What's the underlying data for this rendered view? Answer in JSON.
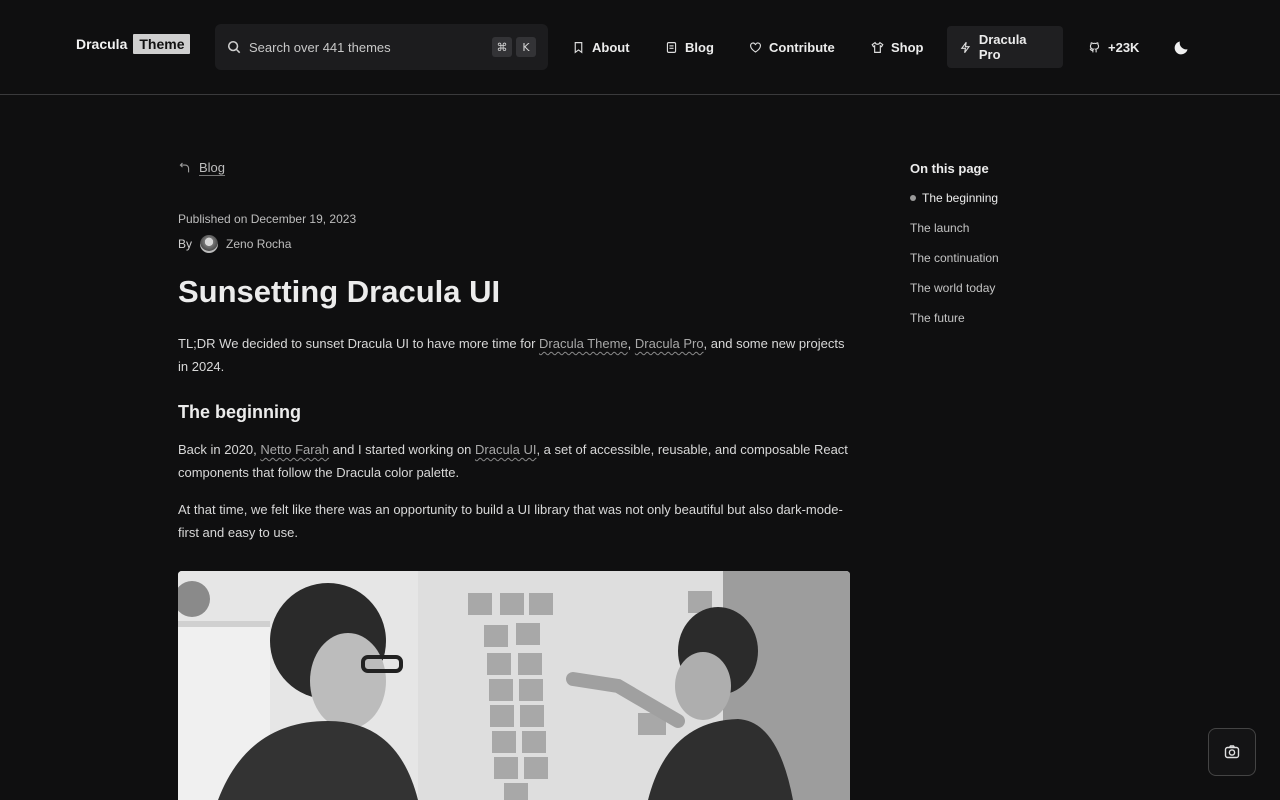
{
  "brand": {
    "name": "Dracula",
    "tag": "Theme"
  },
  "search": {
    "label": "Search over 441 themes",
    "kbd_cmd": "⌘",
    "kbd_key": "K"
  },
  "nav": {
    "about": "About",
    "blog": "Blog",
    "contribute": "Contribute",
    "shop": "Shop",
    "pro": "Dracula Pro",
    "github": "+23K"
  },
  "article": {
    "back_label": "Blog",
    "published": "Published on December 19, 2023",
    "by": "By",
    "author": "Zeno Rocha",
    "title": "Sunsetting Dracula UI",
    "tldr_text_1": "TL;DR We decided to sunset Dracula UI to have more time for ",
    "tldr_link_1": "Dracula Theme",
    "tldr_sep": ", ",
    "tldr_link_2": "Dracula Pro",
    "tldr_text_2": ", and some new projects in 2024.",
    "section_heading": "The beginning",
    "p2_text_1": "Back in 2020, ",
    "p2_link_1": "Netto Farah",
    "p2_text_2": " and I started working on ",
    "p2_link_2": "Dracula UI",
    "p2_text_3": ", a set of accessible, reusable, and composable React components that follow the Dracula color palette.",
    "p3_text": "At that time, we felt like there was an opportunity to build a UI library that was not only beautiful but also dark-mode-first and easy to use."
  },
  "toc": {
    "title": "On this page",
    "items": [
      {
        "label": "The beginning"
      },
      {
        "label": "The launch"
      },
      {
        "label": "The continuation"
      },
      {
        "label": "The world today"
      },
      {
        "label": "The future"
      }
    ]
  },
  "colors": {
    "background": "#0f0f10",
    "text": "#e4e4e4",
    "muted": "#bdbdbd",
    "pro_bg": "#1f1f21"
  }
}
